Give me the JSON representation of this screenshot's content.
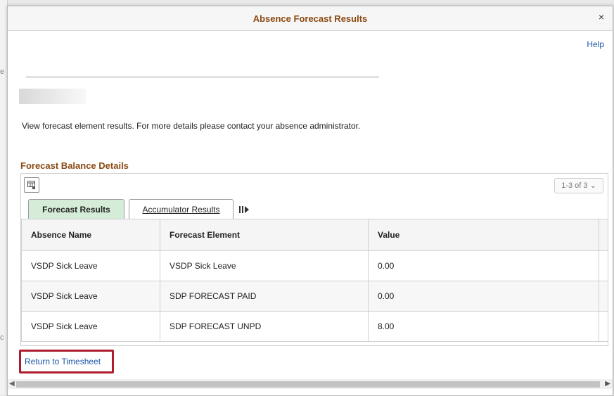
{
  "modal": {
    "title": "Absence Forecast Results",
    "close_label": "×",
    "help_label": "Help"
  },
  "instructions": "View forecast element results. For more details please contact your absence administrator.",
  "section_title": "Forecast Balance Details",
  "grid": {
    "pager_label": "1-3 of 3",
    "tabs": [
      {
        "label": "Forecast Results",
        "active": true
      },
      {
        "label": "Accumulator Results",
        "active": false
      }
    ],
    "columns": [
      "Absence Name",
      "Forecast Element",
      "Value"
    ],
    "rows": [
      [
        "VSDP Sick Leave",
        "VSDP Sick Leave",
        "0.00"
      ],
      [
        "VSDP Sick Leave",
        "SDP FORECAST PAID",
        "0.00"
      ],
      [
        "VSDP Sick Leave",
        "SDP FORECAST UNPD",
        "8.00"
      ]
    ]
  },
  "return_link_label": "Return to Timesheet",
  "colors": {
    "title": "#8a4a12",
    "link": "#1a56a8",
    "active_tab": "#d5ecd9",
    "highlight_border": "#b01c2e"
  },
  "icons": {
    "grid_settings": "grid-personalize-icon",
    "pager_dropdown": "chevron-down-icon",
    "show_all_columns": "show-all-columns-icon",
    "close": "close-icon"
  }
}
